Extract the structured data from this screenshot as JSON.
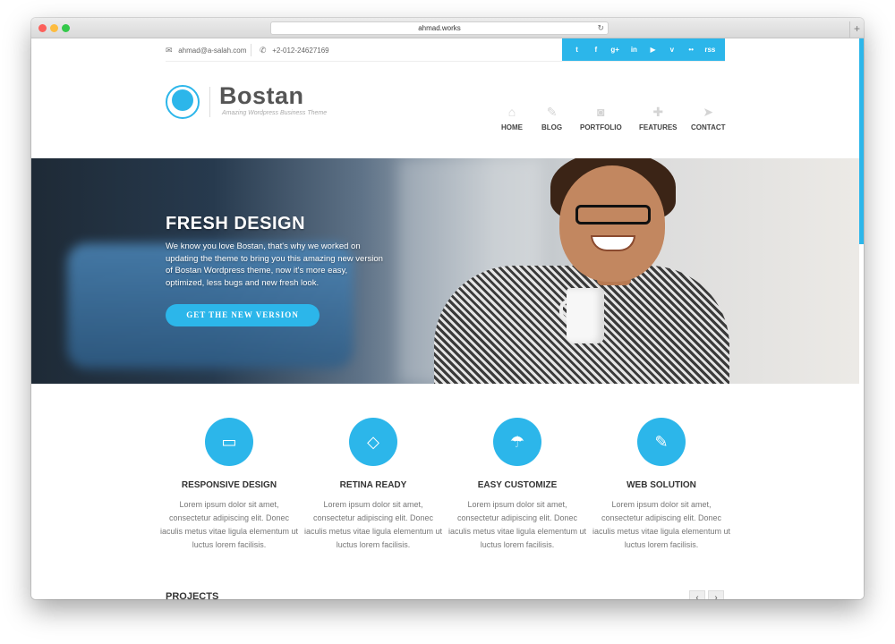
{
  "browser": {
    "url": "ahmad.works",
    "reload_icon": "reload-icon",
    "newtab_label": "+"
  },
  "topbar": {
    "email": "ahmad@a-salah.com",
    "phone": "+2-012-24627169",
    "social": [
      "t",
      "f",
      "g+",
      "in",
      "▶",
      "v",
      "••",
      "rss"
    ]
  },
  "brand": {
    "name": "Bostan",
    "tagline": "Amazing Wordpress Business Theme"
  },
  "nav": [
    {
      "label": "HOME",
      "icon": "home-icon"
    },
    {
      "label": "BLOG",
      "icon": "pencil-icon"
    },
    {
      "label": "PORTFOLIO",
      "icon": "camera-icon"
    },
    {
      "label": "FEATURES",
      "icon": "puzzle-icon"
    },
    {
      "label": "CONTACT",
      "icon": "paper-plane-icon"
    }
  ],
  "hero": {
    "title": "FRESH DESIGN",
    "text": "We know you love Bostan, that's why we worked on updating the theme to bring you this amazing new version of Bostan Wordpress theme, now it's more easy, optimized, less bugs and new fresh look.",
    "button": "GET THE NEW VERSION"
  },
  "features": [
    {
      "title": "RESPONSIVE DESIGN",
      "icon": "monitor-icon",
      "text": "Lorem ipsum dolor sit amet, consectetur adipiscing elit. Donec iaculis metus vitae ligula elementum ut luctus lorem facilisis."
    },
    {
      "title": "RETINA READY",
      "icon": "diamond-icon",
      "text": "Lorem ipsum dolor sit amet, consectetur adipiscing elit. Donec iaculis metus vitae ligula elementum ut luctus lorem facilisis."
    },
    {
      "title": "EASY CUSTOMIZE",
      "icon": "umbrella-icon",
      "text": "Lorem ipsum dolor sit amet, consectetur adipiscing elit. Donec iaculis metus vitae ligula elementum ut luctus lorem facilisis."
    },
    {
      "title": "WEB SOLUTION",
      "icon": "dropper-icon",
      "text": "Lorem ipsum dolor sit amet, consectetur adipiscing elit. Donec iaculis metus vitae ligula elementum ut luctus lorem facilisis."
    }
  ],
  "projects": {
    "title": "PROJECTS",
    "prev": "‹",
    "next": "›"
  },
  "colors": {
    "accent": "#2cb6ea",
    "text_dark": "#333333",
    "text_muted": "#777777"
  }
}
